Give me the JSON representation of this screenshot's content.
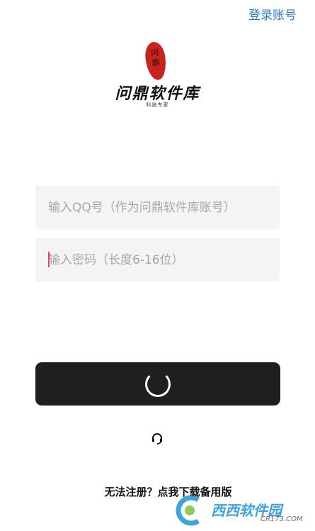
{
  "header": {
    "login_link": "登录账号"
  },
  "logo": {
    "seal_char_1": "问",
    "seal_char_2": "鼎",
    "title": "问鼎软件库",
    "tagline": "科技专家"
  },
  "form": {
    "qq_placeholder": "输入QQ号（作为问鼎软件库账号）",
    "password_placeholder": "输入密码（长度6-16位）"
  },
  "submit": {
    "state": "loading"
  },
  "footer": {
    "register_link": "无法注册？点我下载备用版"
  },
  "watermark": {
    "text": "西西软件园",
    "domain": "CR173.COM"
  },
  "colors": {
    "accent_link": "#2a7bd3",
    "seal_red": "#c8231f",
    "button_bg": "#1f1f1f",
    "field_bg": "#f4f4f4",
    "caret": "#e0457b"
  }
}
